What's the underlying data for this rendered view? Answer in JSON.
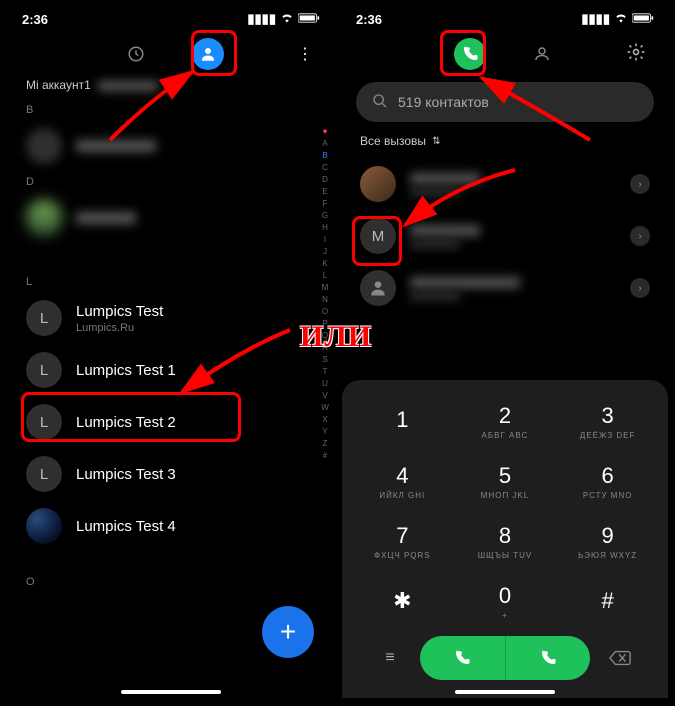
{
  "status": {
    "time": "2:36"
  },
  "or_label": "ИЛИ",
  "left": {
    "account_label": "Mi аккаунт1",
    "sections": {
      "B": "B",
      "D": "D",
      "L": "L",
      "O": "O"
    },
    "contacts": {
      "l0": {
        "name": "Lumpics Test",
        "sub": "Lumpics.Ru",
        "initial": "L"
      },
      "l1": {
        "name": "Lumpics Test 1",
        "initial": "L"
      },
      "l2": {
        "name": "Lumpics Test 2",
        "initial": "L"
      },
      "l3": {
        "name": "Lumpics Test 3",
        "initial": "L"
      },
      "l4": {
        "name": "Lumpics Test 4",
        "initial": ""
      }
    },
    "az_index": [
      "A",
      "B",
      "C",
      "D",
      "E",
      "F",
      "G",
      "H",
      "I",
      "J",
      "K",
      "L",
      "M",
      "N",
      "O",
      "P",
      "Q",
      "R",
      "S",
      "T",
      "U",
      "V",
      "W",
      "X",
      "Y",
      "Z",
      "#"
    ],
    "fab": "+"
  },
  "right": {
    "search_text": "519 контактов",
    "filter_label": "Все вызовы",
    "calls": {
      "c1_initial": "M"
    },
    "dialpad": {
      "1": {
        "num": "1",
        "letters": ""
      },
      "2": {
        "num": "2",
        "letters": "АБВГ  ABC"
      },
      "3": {
        "num": "3",
        "letters": "ДЕЁЖЗ  DEF"
      },
      "4": {
        "num": "4",
        "letters": "ИЙКЛ  GHI"
      },
      "5": {
        "num": "5",
        "letters": "МНОП  JKL"
      },
      "6": {
        "num": "6",
        "letters": "РСТУ  MNO"
      },
      "7": {
        "num": "7",
        "letters": "ФХЦЧ  PQRS"
      },
      "8": {
        "num": "8",
        "letters": "ШЩЪЫ  TUV"
      },
      "9": {
        "num": "9",
        "letters": "ЬЭЮЯ  WXYZ"
      },
      "star": {
        "num": "✱",
        "letters": ""
      },
      "0": {
        "num": "0",
        "letters": "+"
      },
      "hash": {
        "num": "#",
        "letters": ""
      }
    }
  }
}
